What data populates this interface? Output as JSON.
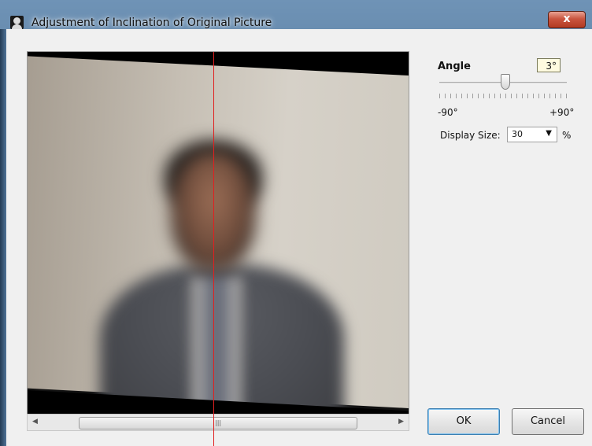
{
  "window": {
    "title": "Adjustment of Inclination of Original Picture",
    "close_label": "x"
  },
  "controls": {
    "angle_label": "Angle",
    "angle_value": "3°",
    "angle_min_label": "-90°",
    "angle_max_label": "+90°",
    "angle_degrees": 3,
    "display_size_label": "Display Size:",
    "display_size_value": "30",
    "display_size_unit": "%"
  },
  "buttons": {
    "ok_label": "OK",
    "cancel_label": "Cancel"
  },
  "colors": {
    "guide_line": "#e02020",
    "angle_field_bg": "#fffbe0"
  },
  "icons": {
    "app": "portrait-silhouette-icon",
    "close": "close-icon",
    "scroll_left": "scroll-left-arrow-icon",
    "scroll_right": "scroll-right-arrow-icon",
    "dropdown": "chevron-down-icon"
  }
}
